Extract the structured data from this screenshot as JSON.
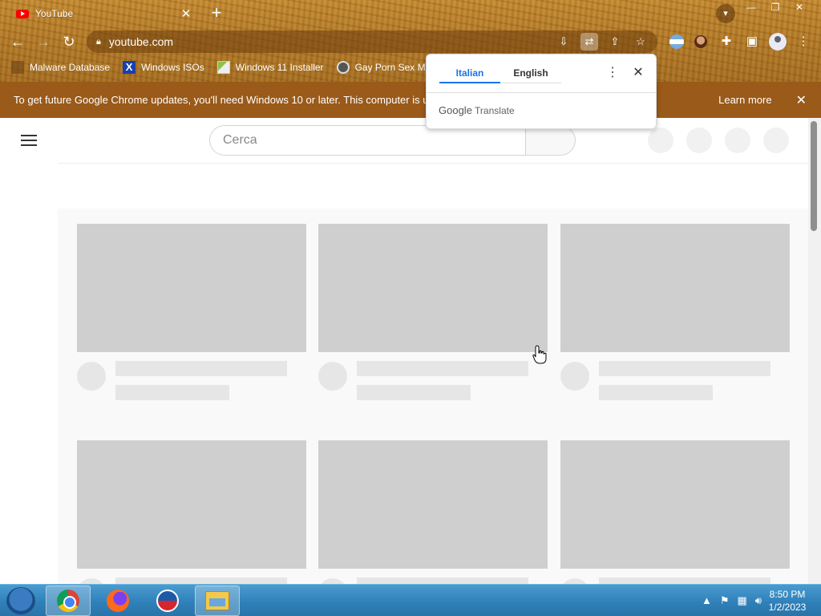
{
  "tab": {
    "title": "YouTube",
    "close": "✕"
  },
  "new_tab": "+",
  "window_controls": {
    "minimize": "—",
    "restore": "❐",
    "close": "✕"
  },
  "omnibox": {
    "url": "youtube.com"
  },
  "bookmarks": [
    {
      "label": "Malware Database",
      "icon": "folder-icon"
    },
    {
      "label": "Windows ISOs",
      "icon": "x-icon"
    },
    {
      "label": "Windows 11 Installer",
      "icon": "image-icon"
    },
    {
      "label": "Gay Porn Sex Mov",
      "icon": "skull-icon"
    }
  ],
  "infobar": {
    "message": "To get future Google Chrome updates, you'll need Windows 10 or later. This computer is usi",
    "learn_more": "Learn more",
    "close": "✕"
  },
  "youtube": {
    "search_placeholder": "Cerca"
  },
  "translate_popup": {
    "source_language": "Italian",
    "target_language": "English",
    "brand_google": "Google",
    "brand_translate": "Translate"
  },
  "taskbar": {
    "time": "8:50 PM",
    "date": "1/2/2023"
  },
  "colors": {
    "youtube_red": "#ff0000",
    "translate_accent": "#1a73e8",
    "infobar": "#9a5a19"
  }
}
